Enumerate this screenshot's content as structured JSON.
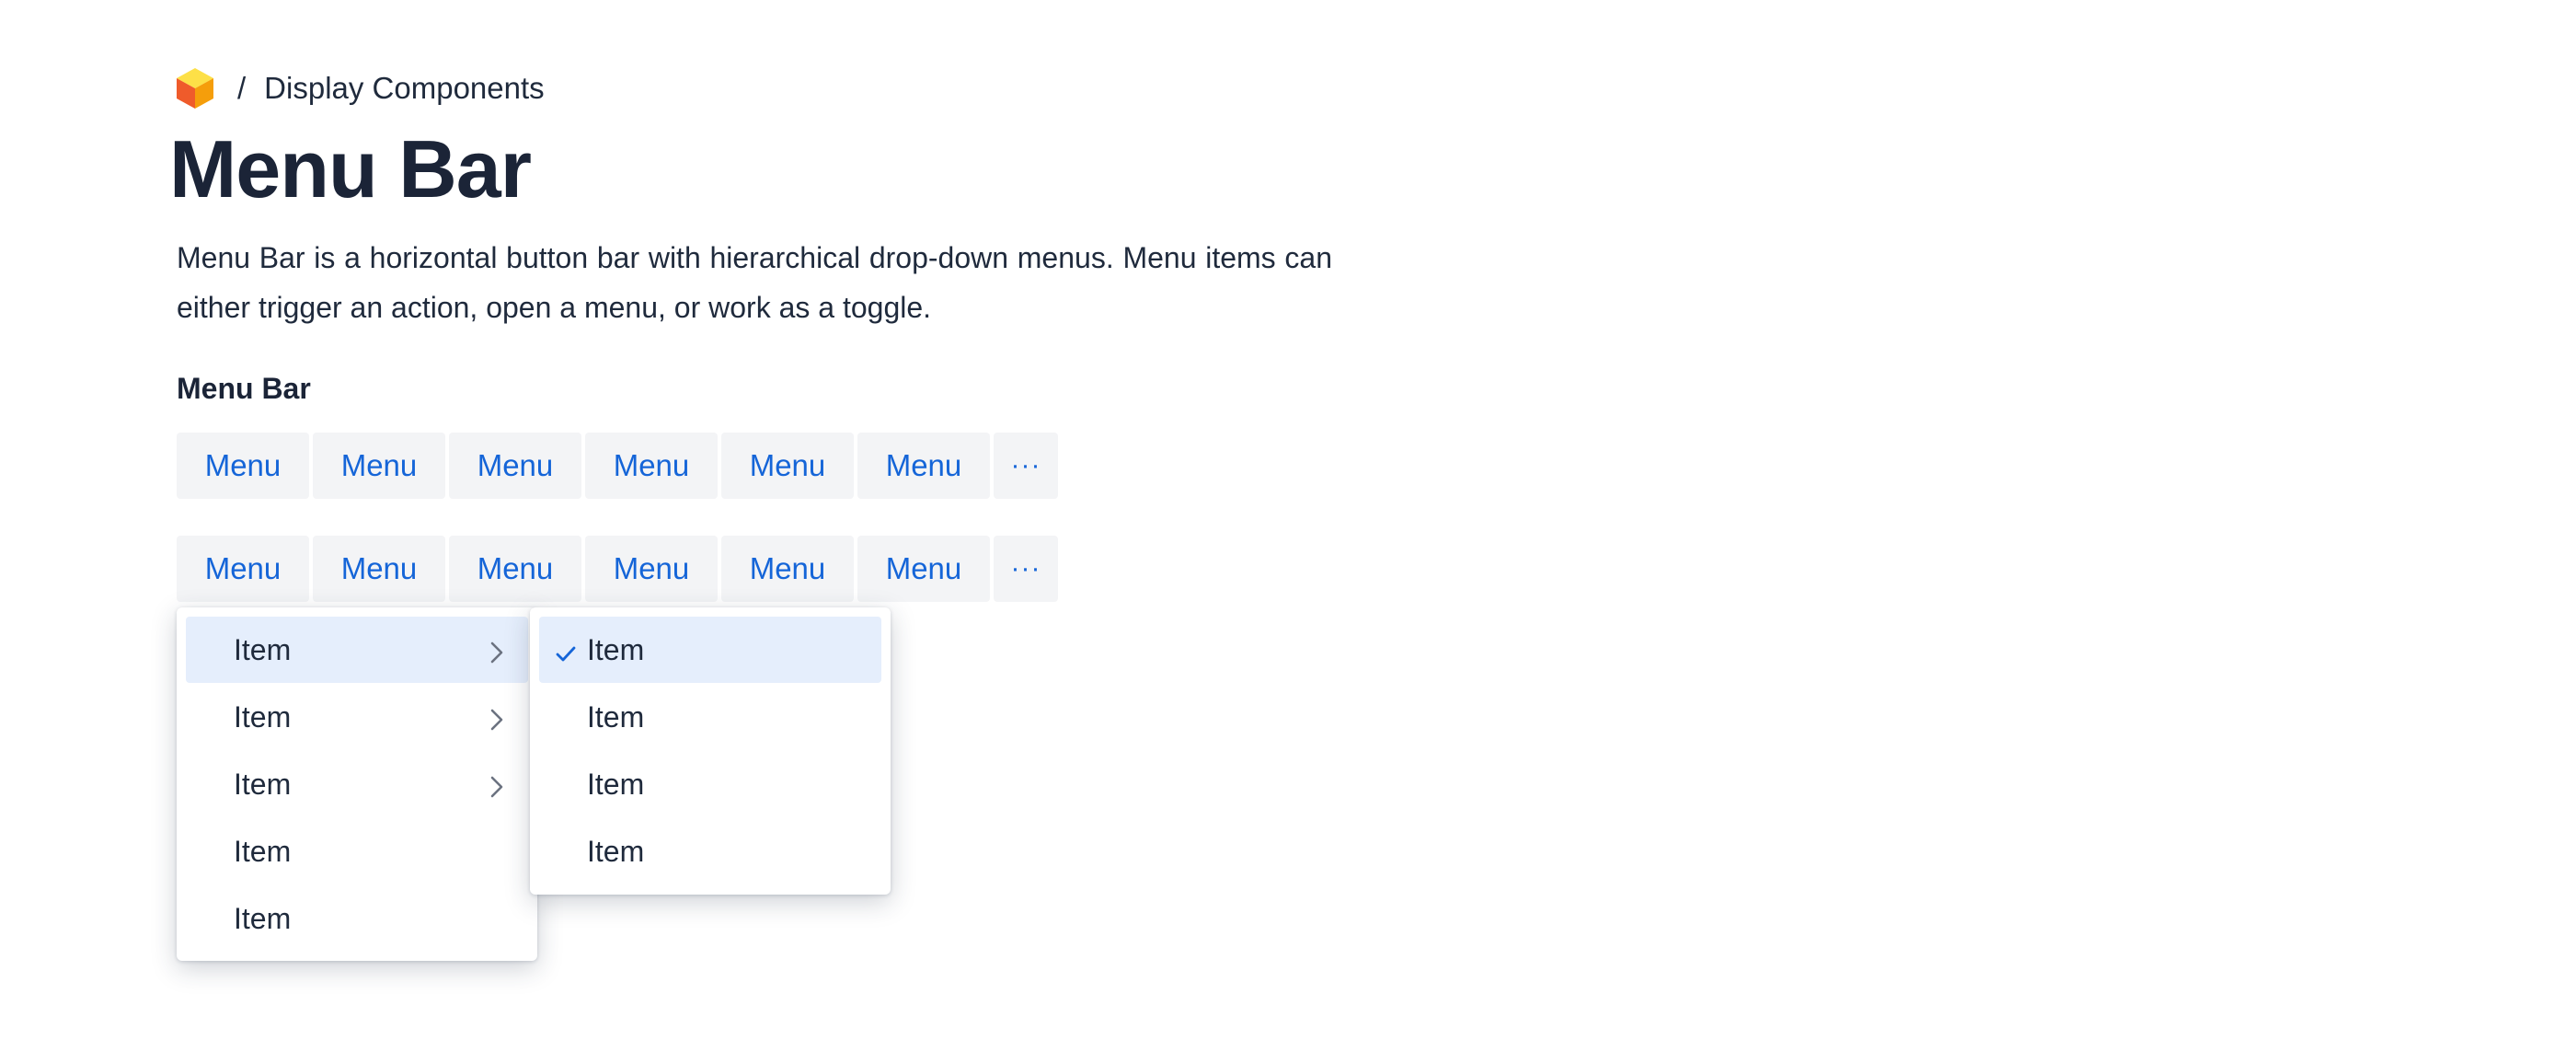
{
  "breadcrumb": {
    "logo_icon": "cube-icon",
    "separator": "/",
    "label": "Display Components"
  },
  "page": {
    "title": "Menu Bar",
    "description": "Menu Bar is a horizontal button bar with hierarchical drop-down menus. Menu items can either trigger an action, open a menu, or work as a toggle."
  },
  "section": {
    "title": "Menu Bar"
  },
  "menubar_1": {
    "items": [
      "Menu",
      "Menu",
      "Menu",
      "Menu",
      "Menu",
      "Menu"
    ],
    "overflow_label": "···"
  },
  "menubar_2": {
    "items": [
      "Menu",
      "Menu",
      "Menu",
      "Menu",
      "Menu",
      "Menu"
    ],
    "overflow_label": "···"
  },
  "dropdown_main": {
    "items": [
      {
        "label": "Item",
        "has_submenu": true,
        "highlighted": true
      },
      {
        "label": "Item",
        "has_submenu": true,
        "highlighted": false
      },
      {
        "label": "Item",
        "has_submenu": true,
        "highlighted": false
      },
      {
        "label": "Item",
        "has_submenu": false,
        "highlighted": false
      },
      {
        "label": "Item",
        "has_submenu": false,
        "highlighted": false
      }
    ]
  },
  "dropdown_sub": {
    "items": [
      {
        "label": "Item",
        "checked": true,
        "highlighted": true
      },
      {
        "label": "Item",
        "checked": false,
        "highlighted": false
      },
      {
        "label": "Item",
        "checked": false,
        "highlighted": false
      },
      {
        "label": "Item",
        "checked": false,
        "highlighted": false
      }
    ]
  },
  "colors": {
    "accent": "#1565d8",
    "button_bg": "#f3f4f6",
    "highlight_bg": "#e5eefc",
    "text": "#1f2a3c"
  }
}
